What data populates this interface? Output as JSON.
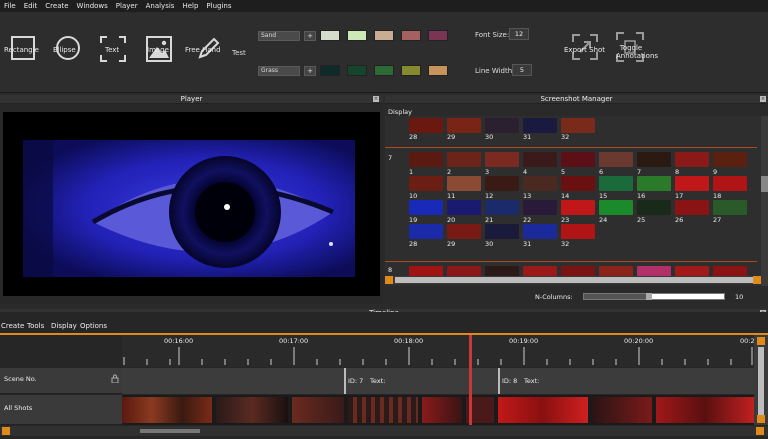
{
  "menu": [
    "File",
    "Edit",
    "Create",
    "Windows",
    "Player",
    "Analysis",
    "Help",
    "Plugins"
  ],
  "tools": {
    "rectangle": "Rectangle",
    "ellipse": "Ellipse",
    "text": "Text",
    "image": "Image",
    "freehand": "Free Hand",
    "test": "Test"
  },
  "palettes": [
    {
      "name": "Sand",
      "colors": [
        "#d6dccb",
        "#cce8b6",
        "#c8ad94",
        "#a56060",
        "#7a3456"
      ]
    },
    {
      "name": "Grass",
      "colors": [
        "#0e2a2a",
        "#16442c",
        "#2d6a36",
        "#858a2e",
        "#c7935a"
      ]
    }
  ],
  "font_size": {
    "label": "Font Size:",
    "value": "12"
  },
  "line_width": {
    "label": "Line Width:",
    "value": "5"
  },
  "export_shot": "Export Shot",
  "toggle_annotations": "Toggle Annotations",
  "player_title": "Player",
  "ssm": {
    "title": "Screenshot Manager",
    "display": "Display",
    "row_top_numbers": [
      "28",
      "29",
      "30",
      "31",
      "32"
    ],
    "group7": {
      "label": "7",
      "row1": [
        "1",
        "2",
        "3",
        "4",
        "5",
        "6",
        "7",
        "8",
        "9"
      ],
      "row2": [
        "10",
        "11",
        "12",
        "13",
        "14",
        "15",
        "16",
        "17",
        "18"
      ],
      "row3": [
        "19",
        "20",
        "21",
        "22",
        "23",
        "24",
        "25",
        "26",
        "27"
      ],
      "row4": [
        "28",
        "29",
        "30",
        "31",
        "32"
      ]
    },
    "group8": "8",
    "ncolumns_label": "N-Columns:",
    "ncolumns_value": "10"
  },
  "timeline": {
    "title": "Timeline",
    "menu": [
      "Create",
      "Tools",
      "Display",
      "Options"
    ],
    "ticks": [
      "00:16:00",
      "00:17:00",
      "00:18:00",
      "00:19:00",
      "00:20:00",
      "00:2"
    ],
    "tracks": [
      "Scene No.",
      "All Shots"
    ],
    "segments": [
      {
        "id": "ID: 7",
        "text": "Text:"
      },
      {
        "id": "ID: 8",
        "text": "Text:"
      }
    ]
  }
}
